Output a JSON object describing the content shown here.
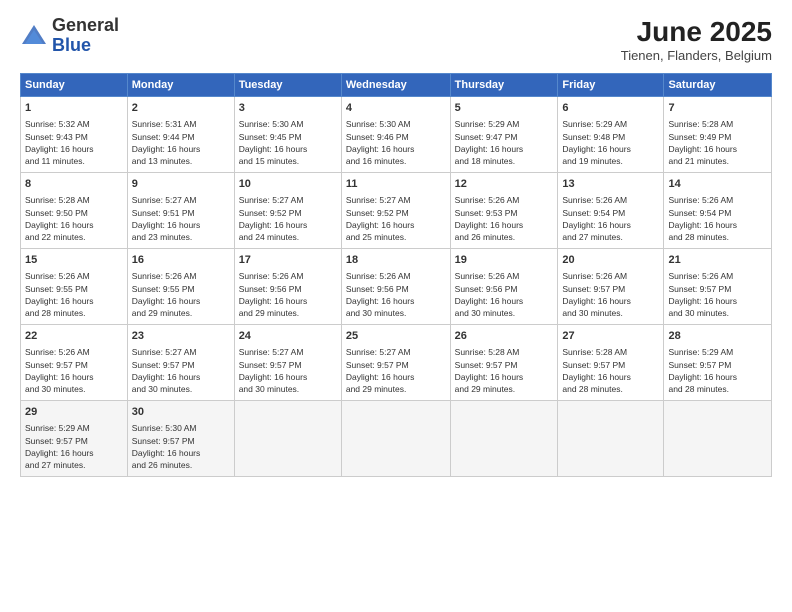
{
  "header": {
    "logo_line1": "General",
    "logo_line2": "Blue",
    "month_year": "June 2025",
    "location": "Tienen, Flanders, Belgium"
  },
  "days_of_week": [
    "Sunday",
    "Monday",
    "Tuesday",
    "Wednesday",
    "Thursday",
    "Friday",
    "Saturday"
  ],
  "weeks": [
    [
      {
        "day": 1,
        "info": "Sunrise: 5:32 AM\nSunset: 9:43 PM\nDaylight: 16 hours\nand 11 minutes."
      },
      {
        "day": 2,
        "info": "Sunrise: 5:31 AM\nSunset: 9:44 PM\nDaylight: 16 hours\nand 13 minutes."
      },
      {
        "day": 3,
        "info": "Sunrise: 5:30 AM\nSunset: 9:45 PM\nDaylight: 16 hours\nand 15 minutes."
      },
      {
        "day": 4,
        "info": "Sunrise: 5:30 AM\nSunset: 9:46 PM\nDaylight: 16 hours\nand 16 minutes."
      },
      {
        "day": 5,
        "info": "Sunrise: 5:29 AM\nSunset: 9:47 PM\nDaylight: 16 hours\nand 18 minutes."
      },
      {
        "day": 6,
        "info": "Sunrise: 5:29 AM\nSunset: 9:48 PM\nDaylight: 16 hours\nand 19 minutes."
      },
      {
        "day": 7,
        "info": "Sunrise: 5:28 AM\nSunset: 9:49 PM\nDaylight: 16 hours\nand 21 minutes."
      }
    ],
    [
      {
        "day": 8,
        "info": "Sunrise: 5:28 AM\nSunset: 9:50 PM\nDaylight: 16 hours\nand 22 minutes."
      },
      {
        "day": 9,
        "info": "Sunrise: 5:27 AM\nSunset: 9:51 PM\nDaylight: 16 hours\nand 23 minutes."
      },
      {
        "day": 10,
        "info": "Sunrise: 5:27 AM\nSunset: 9:52 PM\nDaylight: 16 hours\nand 24 minutes."
      },
      {
        "day": 11,
        "info": "Sunrise: 5:27 AM\nSunset: 9:52 PM\nDaylight: 16 hours\nand 25 minutes."
      },
      {
        "day": 12,
        "info": "Sunrise: 5:26 AM\nSunset: 9:53 PM\nDaylight: 16 hours\nand 26 minutes."
      },
      {
        "day": 13,
        "info": "Sunrise: 5:26 AM\nSunset: 9:54 PM\nDaylight: 16 hours\nand 27 minutes."
      },
      {
        "day": 14,
        "info": "Sunrise: 5:26 AM\nSunset: 9:54 PM\nDaylight: 16 hours\nand 28 minutes."
      }
    ],
    [
      {
        "day": 15,
        "info": "Sunrise: 5:26 AM\nSunset: 9:55 PM\nDaylight: 16 hours\nand 28 minutes."
      },
      {
        "day": 16,
        "info": "Sunrise: 5:26 AM\nSunset: 9:55 PM\nDaylight: 16 hours\nand 29 minutes."
      },
      {
        "day": 17,
        "info": "Sunrise: 5:26 AM\nSunset: 9:56 PM\nDaylight: 16 hours\nand 29 minutes."
      },
      {
        "day": 18,
        "info": "Sunrise: 5:26 AM\nSunset: 9:56 PM\nDaylight: 16 hours\nand 30 minutes."
      },
      {
        "day": 19,
        "info": "Sunrise: 5:26 AM\nSunset: 9:56 PM\nDaylight: 16 hours\nand 30 minutes."
      },
      {
        "day": 20,
        "info": "Sunrise: 5:26 AM\nSunset: 9:57 PM\nDaylight: 16 hours\nand 30 minutes."
      },
      {
        "day": 21,
        "info": "Sunrise: 5:26 AM\nSunset: 9:57 PM\nDaylight: 16 hours\nand 30 minutes."
      }
    ],
    [
      {
        "day": 22,
        "info": "Sunrise: 5:26 AM\nSunset: 9:57 PM\nDaylight: 16 hours\nand 30 minutes."
      },
      {
        "day": 23,
        "info": "Sunrise: 5:27 AM\nSunset: 9:57 PM\nDaylight: 16 hours\nand 30 minutes."
      },
      {
        "day": 24,
        "info": "Sunrise: 5:27 AM\nSunset: 9:57 PM\nDaylight: 16 hours\nand 30 minutes."
      },
      {
        "day": 25,
        "info": "Sunrise: 5:27 AM\nSunset: 9:57 PM\nDaylight: 16 hours\nand 29 minutes."
      },
      {
        "day": 26,
        "info": "Sunrise: 5:28 AM\nSunset: 9:57 PM\nDaylight: 16 hours\nand 29 minutes."
      },
      {
        "day": 27,
        "info": "Sunrise: 5:28 AM\nSunset: 9:57 PM\nDaylight: 16 hours\nand 28 minutes."
      },
      {
        "day": 28,
        "info": "Sunrise: 5:29 AM\nSunset: 9:57 PM\nDaylight: 16 hours\nand 28 minutes."
      }
    ],
    [
      {
        "day": 29,
        "info": "Sunrise: 5:29 AM\nSunset: 9:57 PM\nDaylight: 16 hours\nand 27 minutes."
      },
      {
        "day": 30,
        "info": "Sunrise: 5:30 AM\nSunset: 9:57 PM\nDaylight: 16 hours\nand 26 minutes."
      },
      null,
      null,
      null,
      null,
      null
    ]
  ]
}
